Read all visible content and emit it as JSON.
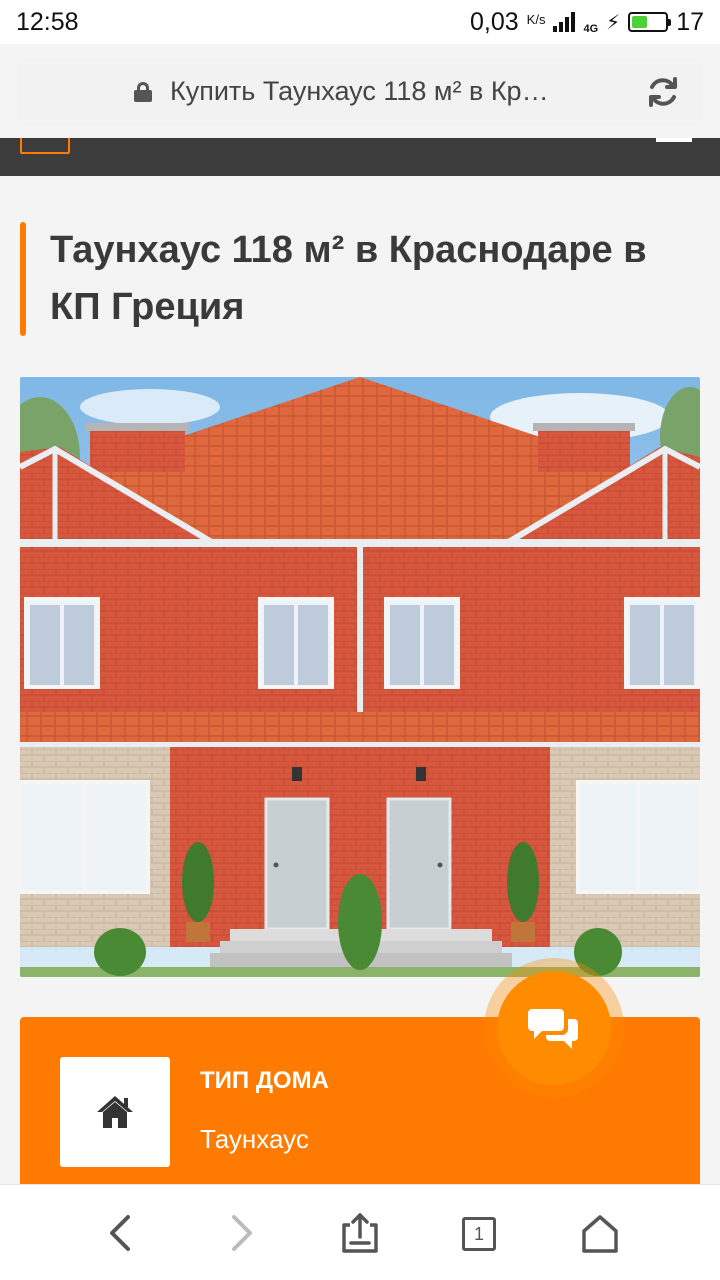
{
  "status": {
    "time": "12:58",
    "speed": "0,03",
    "speed_unit": "K/s",
    "network": "4G",
    "battery": "17",
    "battery_fill": 0.45
  },
  "browser": {
    "url_title": "Купить Таунхаус 118 м² в Кр…",
    "tabs_count": "1"
  },
  "page": {
    "title": "Таунхаус 118 м² в Краснодаре в КП Греция",
    "info": {
      "label": "ТИП ДОМА",
      "value": "Таунхаус"
    }
  },
  "colors": {
    "accent": "#ff7a00",
    "header": "#3c3c3c",
    "title": "#3a3a3a"
  },
  "icons": [
    "lock-icon",
    "reload-icon",
    "menu-icon",
    "house-icon",
    "chat-icon",
    "back-icon",
    "forward-icon",
    "share-icon",
    "tabs-icon",
    "home-icon"
  ]
}
